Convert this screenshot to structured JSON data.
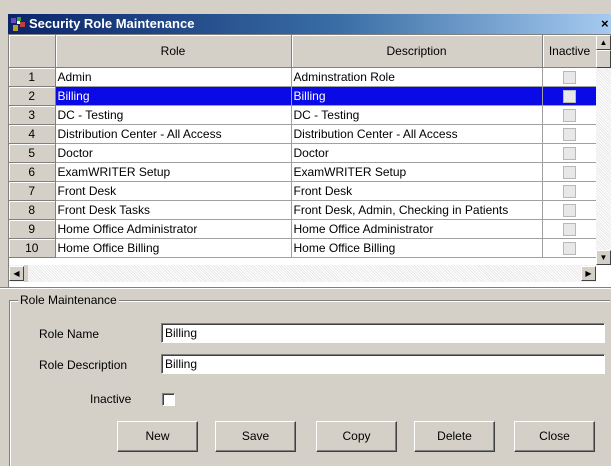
{
  "window": {
    "title": "Security Role Maintenance",
    "close_glyph": "×"
  },
  "grid": {
    "columns": {
      "role": "Role",
      "description": "Description",
      "inactive": "Inactive"
    },
    "selected_row": 2,
    "rows": [
      {
        "num": "1",
        "role": "Admin",
        "description": "Adminstration Role",
        "inactive": false
      },
      {
        "num": "2",
        "role": "Billing",
        "description": "Billing",
        "inactive": false
      },
      {
        "num": "3",
        "role": "DC - Testing",
        "description": "DC - Testing",
        "inactive": false
      },
      {
        "num": "4",
        "role": "Distribution Center - All Access",
        "description": "Distribution Center - All Access",
        "inactive": false
      },
      {
        "num": "5",
        "role": "Doctor",
        "description": "Doctor",
        "inactive": false
      },
      {
        "num": "6",
        "role": "ExamWRITER Setup",
        "description": "ExamWRITER Setup",
        "inactive": false
      },
      {
        "num": "7",
        "role": "Front Desk",
        "description": "Front Desk",
        "inactive": false
      },
      {
        "num": "8",
        "role": "Front Desk Tasks",
        "description": "Front Desk, Admin, Checking in Patients",
        "inactive": false
      },
      {
        "num": "9",
        "role": "Home Office Administrator",
        "description": "Home Office Administrator",
        "inactive": false
      },
      {
        "num": "10",
        "role": "Home Office Billing",
        "description": "Home Office Billing",
        "inactive": false
      }
    ]
  },
  "form": {
    "group_title": "Role Maintenance",
    "role_name_label": "Role Name",
    "role_name_value": "Billing",
    "role_description_label": "Role Description",
    "role_description_value": "Billing",
    "inactive_label": "Inactive",
    "inactive_checked": false
  },
  "buttons": {
    "new": "New",
    "save": "Save",
    "copy": "Copy",
    "delete": "Delete",
    "close": "Close"
  },
  "colors": {
    "selection": "#0a0ae6",
    "title_bar": "#0a246a",
    "window_face": "#d4d0c8"
  },
  "icons": {
    "title": "app-icon",
    "scroll_up": "scroll-up-arrow-icon",
    "scroll_down": "scroll-down-arrow-icon",
    "scroll_left": "scroll-left-arrow-icon",
    "scroll_right": "scroll-right-arrow-icon"
  }
}
